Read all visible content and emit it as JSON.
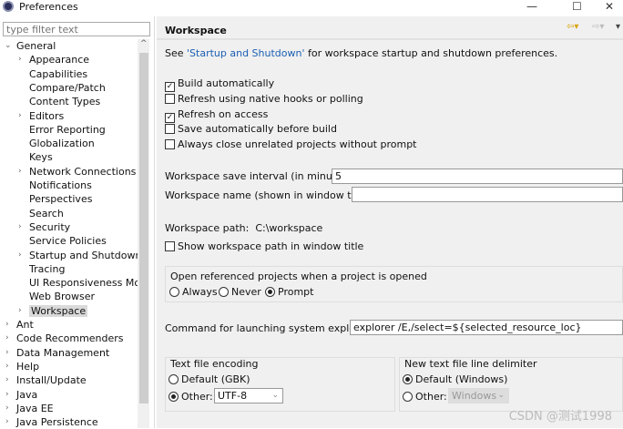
{
  "window": {
    "title": "Preferences",
    "minimize": "—",
    "maximize": "☐",
    "close": "✕"
  },
  "filter": {
    "placeholder": "type filter text"
  },
  "tree": [
    {
      "label": "General",
      "level": 0,
      "arrow": "v"
    },
    {
      "label": "Appearance",
      "level": 1,
      "arrow": ">"
    },
    {
      "label": "Capabilities",
      "level": 1,
      "arrow": ""
    },
    {
      "label": "Compare/Patch",
      "level": 1,
      "arrow": ""
    },
    {
      "label": "Content Types",
      "level": 1,
      "arrow": ""
    },
    {
      "label": "Editors",
      "level": 1,
      "arrow": ">"
    },
    {
      "label": "Error Reporting",
      "level": 1,
      "arrow": ""
    },
    {
      "label": "Globalization",
      "level": 1,
      "arrow": ""
    },
    {
      "label": "Keys",
      "level": 1,
      "arrow": ""
    },
    {
      "label": "Network Connections",
      "level": 1,
      "arrow": ">"
    },
    {
      "label": "Notifications",
      "level": 1,
      "arrow": ""
    },
    {
      "label": "Perspectives",
      "level": 1,
      "arrow": ""
    },
    {
      "label": "Search",
      "level": 1,
      "arrow": ""
    },
    {
      "label": "Security",
      "level": 1,
      "arrow": ">"
    },
    {
      "label": "Service Policies",
      "level": 1,
      "arrow": ""
    },
    {
      "label": "Startup and Shutdown",
      "level": 1,
      "arrow": ">"
    },
    {
      "label": "Tracing",
      "level": 1,
      "arrow": ""
    },
    {
      "label": "UI Responsiveness Moni",
      "level": 1,
      "arrow": ""
    },
    {
      "label": "Web Browser",
      "level": 1,
      "arrow": ""
    },
    {
      "label": "Workspace",
      "level": 1,
      "arrow": ">",
      "selected": true
    },
    {
      "label": "Ant",
      "level": 0,
      "arrow": ">"
    },
    {
      "label": "Code Recommenders",
      "level": 0,
      "arrow": ">"
    },
    {
      "label": "Data Management",
      "level": 0,
      "arrow": ">"
    },
    {
      "label": "Help",
      "level": 0,
      "arrow": ">"
    },
    {
      "label": "Install/Update",
      "level": 0,
      "arrow": ">"
    },
    {
      "label": "Java",
      "level": 0,
      "arrow": ">"
    },
    {
      "label": "Java EE",
      "level": 0,
      "arrow": ">"
    },
    {
      "label": "Java Persistence",
      "level": 0,
      "arrow": ">"
    }
  ],
  "page": {
    "title": "Workspace",
    "see_prefix": "See ",
    "see_link": "'Startup and Shutdown'",
    "see_suffix": " for workspace startup and shutdown preferences.",
    "checkboxes": [
      {
        "label": "Build automatically",
        "checked": true
      },
      {
        "label": "Refresh using native hooks or polling",
        "checked": false
      },
      {
        "label": "Refresh on access",
        "checked": true
      },
      {
        "label": "Save automatically before build",
        "checked": false
      },
      {
        "label": "Always close unrelated projects without prompt",
        "checked": false
      }
    ],
    "save_interval_label": "Workspace save interval (in minutes):",
    "save_interval_value": "5",
    "name_label": "Workspace name (shown in window title):",
    "name_value": "",
    "path_label": "Workspace path:",
    "path_value": "C:\\workspace",
    "show_path_label": "Show workspace path in window title",
    "open_ref_label": "Open referenced projects when a project is opened",
    "open_ref_options": [
      "Always",
      "Never",
      "Prompt"
    ],
    "explorer_label": "Command for launching system explorer:",
    "explorer_value": "explorer /E,/select=${selected_resource_loc}",
    "encoding_label": "Text file encoding",
    "encoding_default": "Default (GBK)",
    "encoding_other": "Other:",
    "encoding_value": "UTF-8",
    "delim_label": "New text file line delimiter",
    "delim_default": "Default (Windows)",
    "delim_other": "Other:",
    "delim_value": "Windows"
  },
  "watermark": "CSDN @测试1998"
}
